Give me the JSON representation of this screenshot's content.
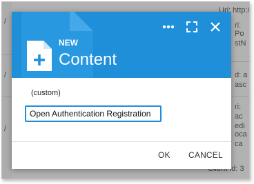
{
  "background": {
    "right_fragments": [
      "Uri: http:/",
      "ri:",
      "Po",
      "stN",
      "",
      "d: a",
      "asc",
      "ri:",
      "ac",
      "edi",
      "oca",
      "ca",
      "Client Id: 3"
    ],
    "left_fragments": [
      "/",
      "/",
      "/"
    ]
  },
  "dialog": {
    "header": {
      "kicker": "NEW",
      "title": "Content",
      "more_label": "more-options",
      "color": "#1f8fd9"
    },
    "field": {
      "label": "(custom)",
      "value": "Open Authentication Registration"
    },
    "footer": {
      "ok_label": "OK",
      "cancel_label": "CANCEL"
    }
  }
}
